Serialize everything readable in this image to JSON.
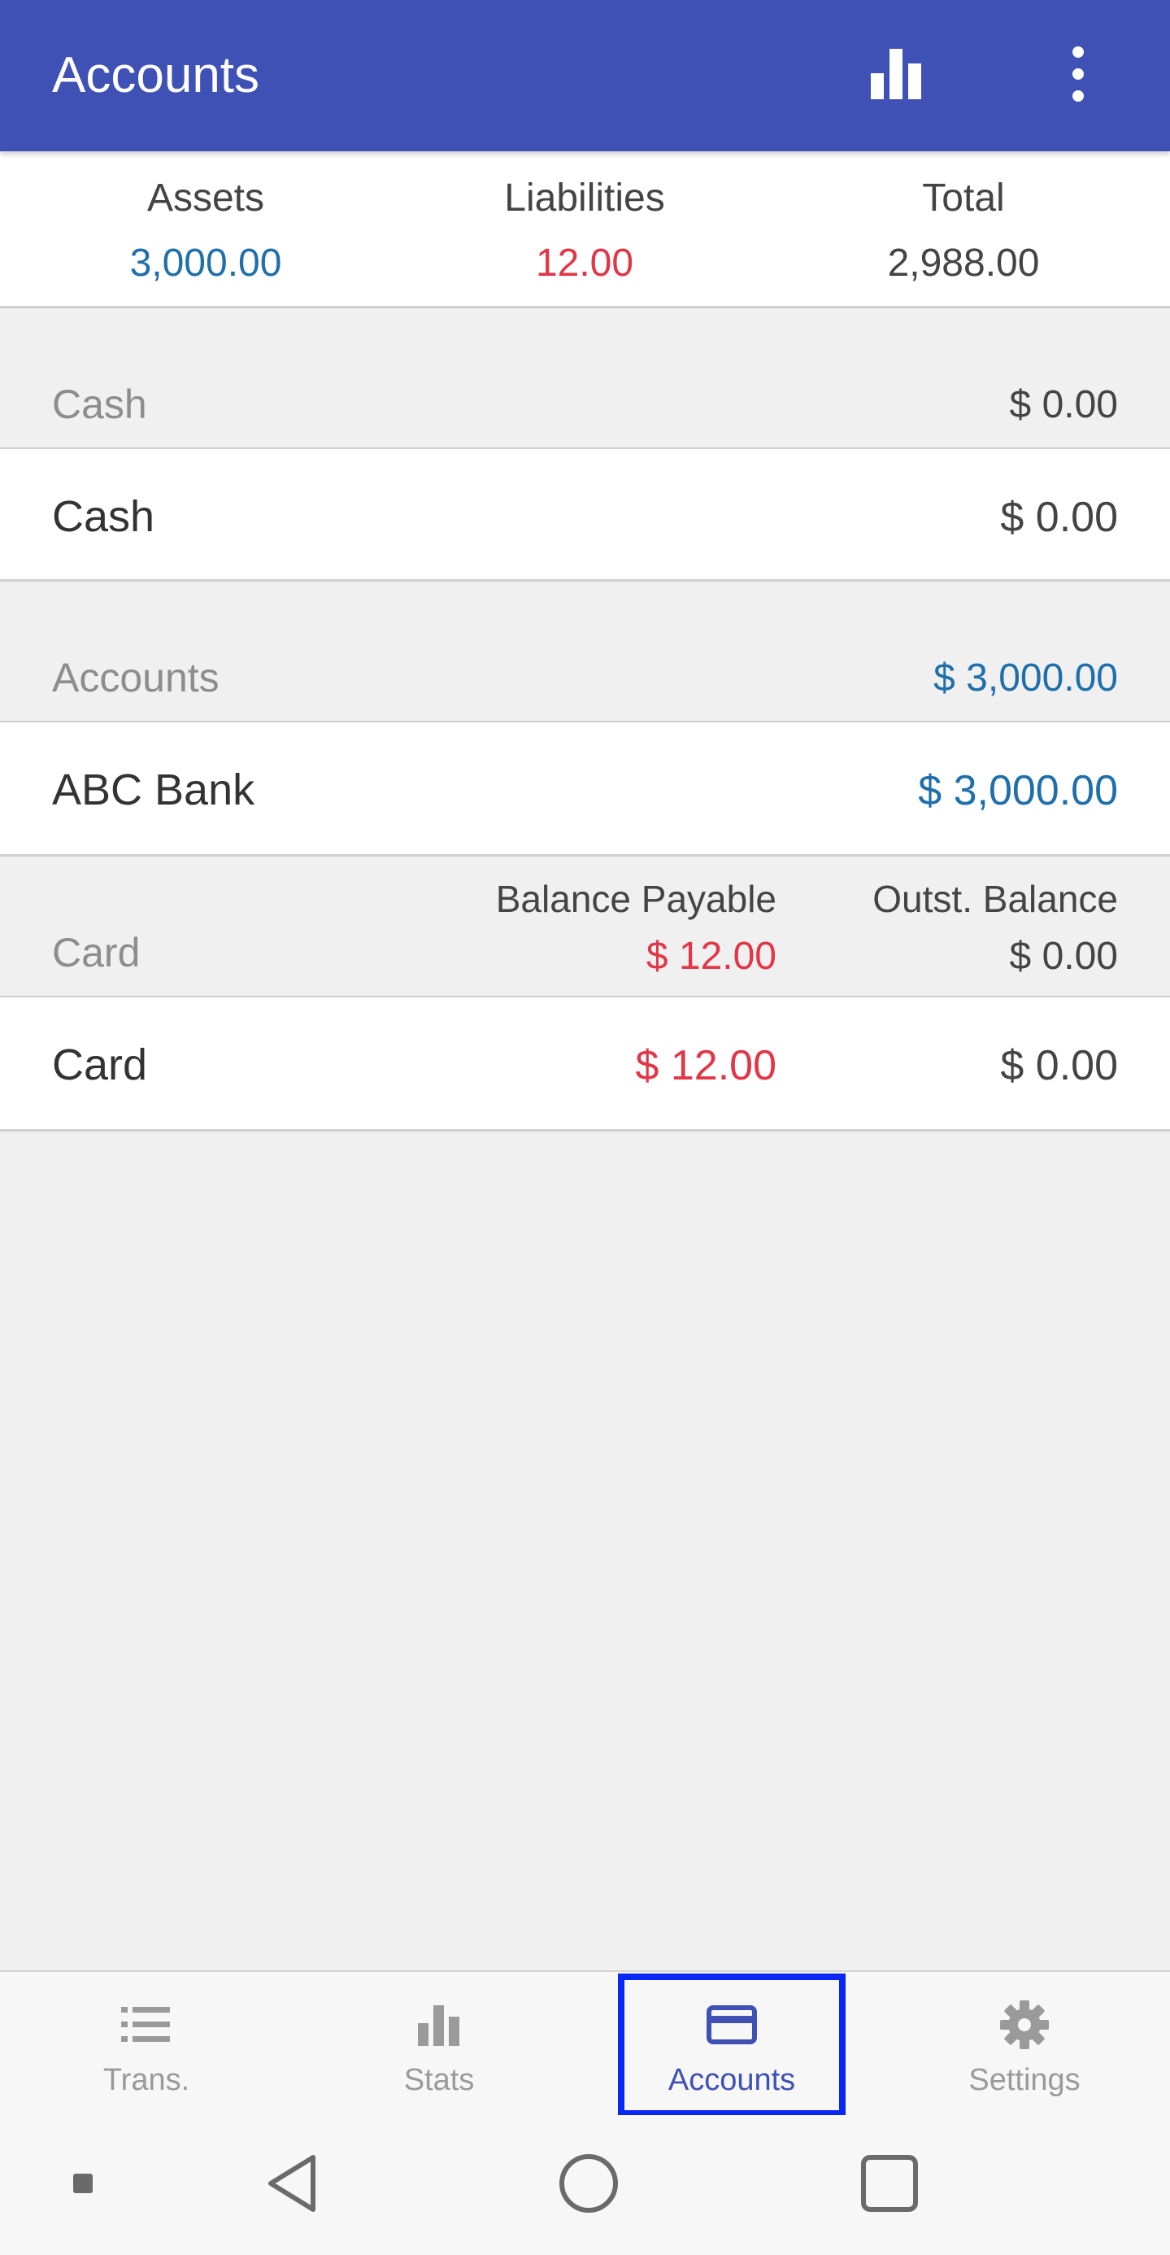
{
  "appbar": {
    "title": "Accounts",
    "icons": [
      "bar-chart-icon",
      "more-vert-icon"
    ]
  },
  "summary": {
    "assets": {
      "label": "Assets",
      "value": "3,000.00"
    },
    "liabilities": {
      "label": "Liabilities",
      "value": "12.00"
    },
    "total": {
      "label": "Total",
      "value": "2,988.00"
    }
  },
  "groups": {
    "cash": {
      "name": "Cash",
      "total": "$ 0.00",
      "items": [
        {
          "name": "Cash",
          "amount": "$ 0.00"
        }
      ]
    },
    "accounts": {
      "name": "Accounts",
      "total": "$ 3,000.00",
      "items": [
        {
          "name": "ABC Bank",
          "amount": "$ 3,000.00"
        }
      ]
    },
    "card": {
      "name": "Card",
      "balance_payable_label": "Balance Payable",
      "balance_payable": "$ 12.00",
      "outst_balance_label": "Outst. Balance",
      "outst_balance": "$ 0.00",
      "items": [
        {
          "name": "Card",
          "balance_payable": "$ 12.00",
          "outst_balance": "$ 0.00"
        }
      ]
    }
  },
  "bottom_nav": {
    "items": [
      {
        "label": "Trans.",
        "icon": "list-icon"
      },
      {
        "label": "Stats",
        "icon": "bar-chart-icon"
      },
      {
        "label": "Accounts",
        "icon": "credit-card-icon"
      },
      {
        "label": "Settings",
        "icon": "gear-icon"
      }
    ],
    "active_index": 2
  },
  "system_nav": [
    "square-small-icon",
    "back-icon",
    "home-icon",
    "recents-icon"
  ],
  "colors": {
    "primary": "#3f51b5",
    "positive": "#1f6fab",
    "negative": "#e23648",
    "highlight": "#0a28f5"
  }
}
